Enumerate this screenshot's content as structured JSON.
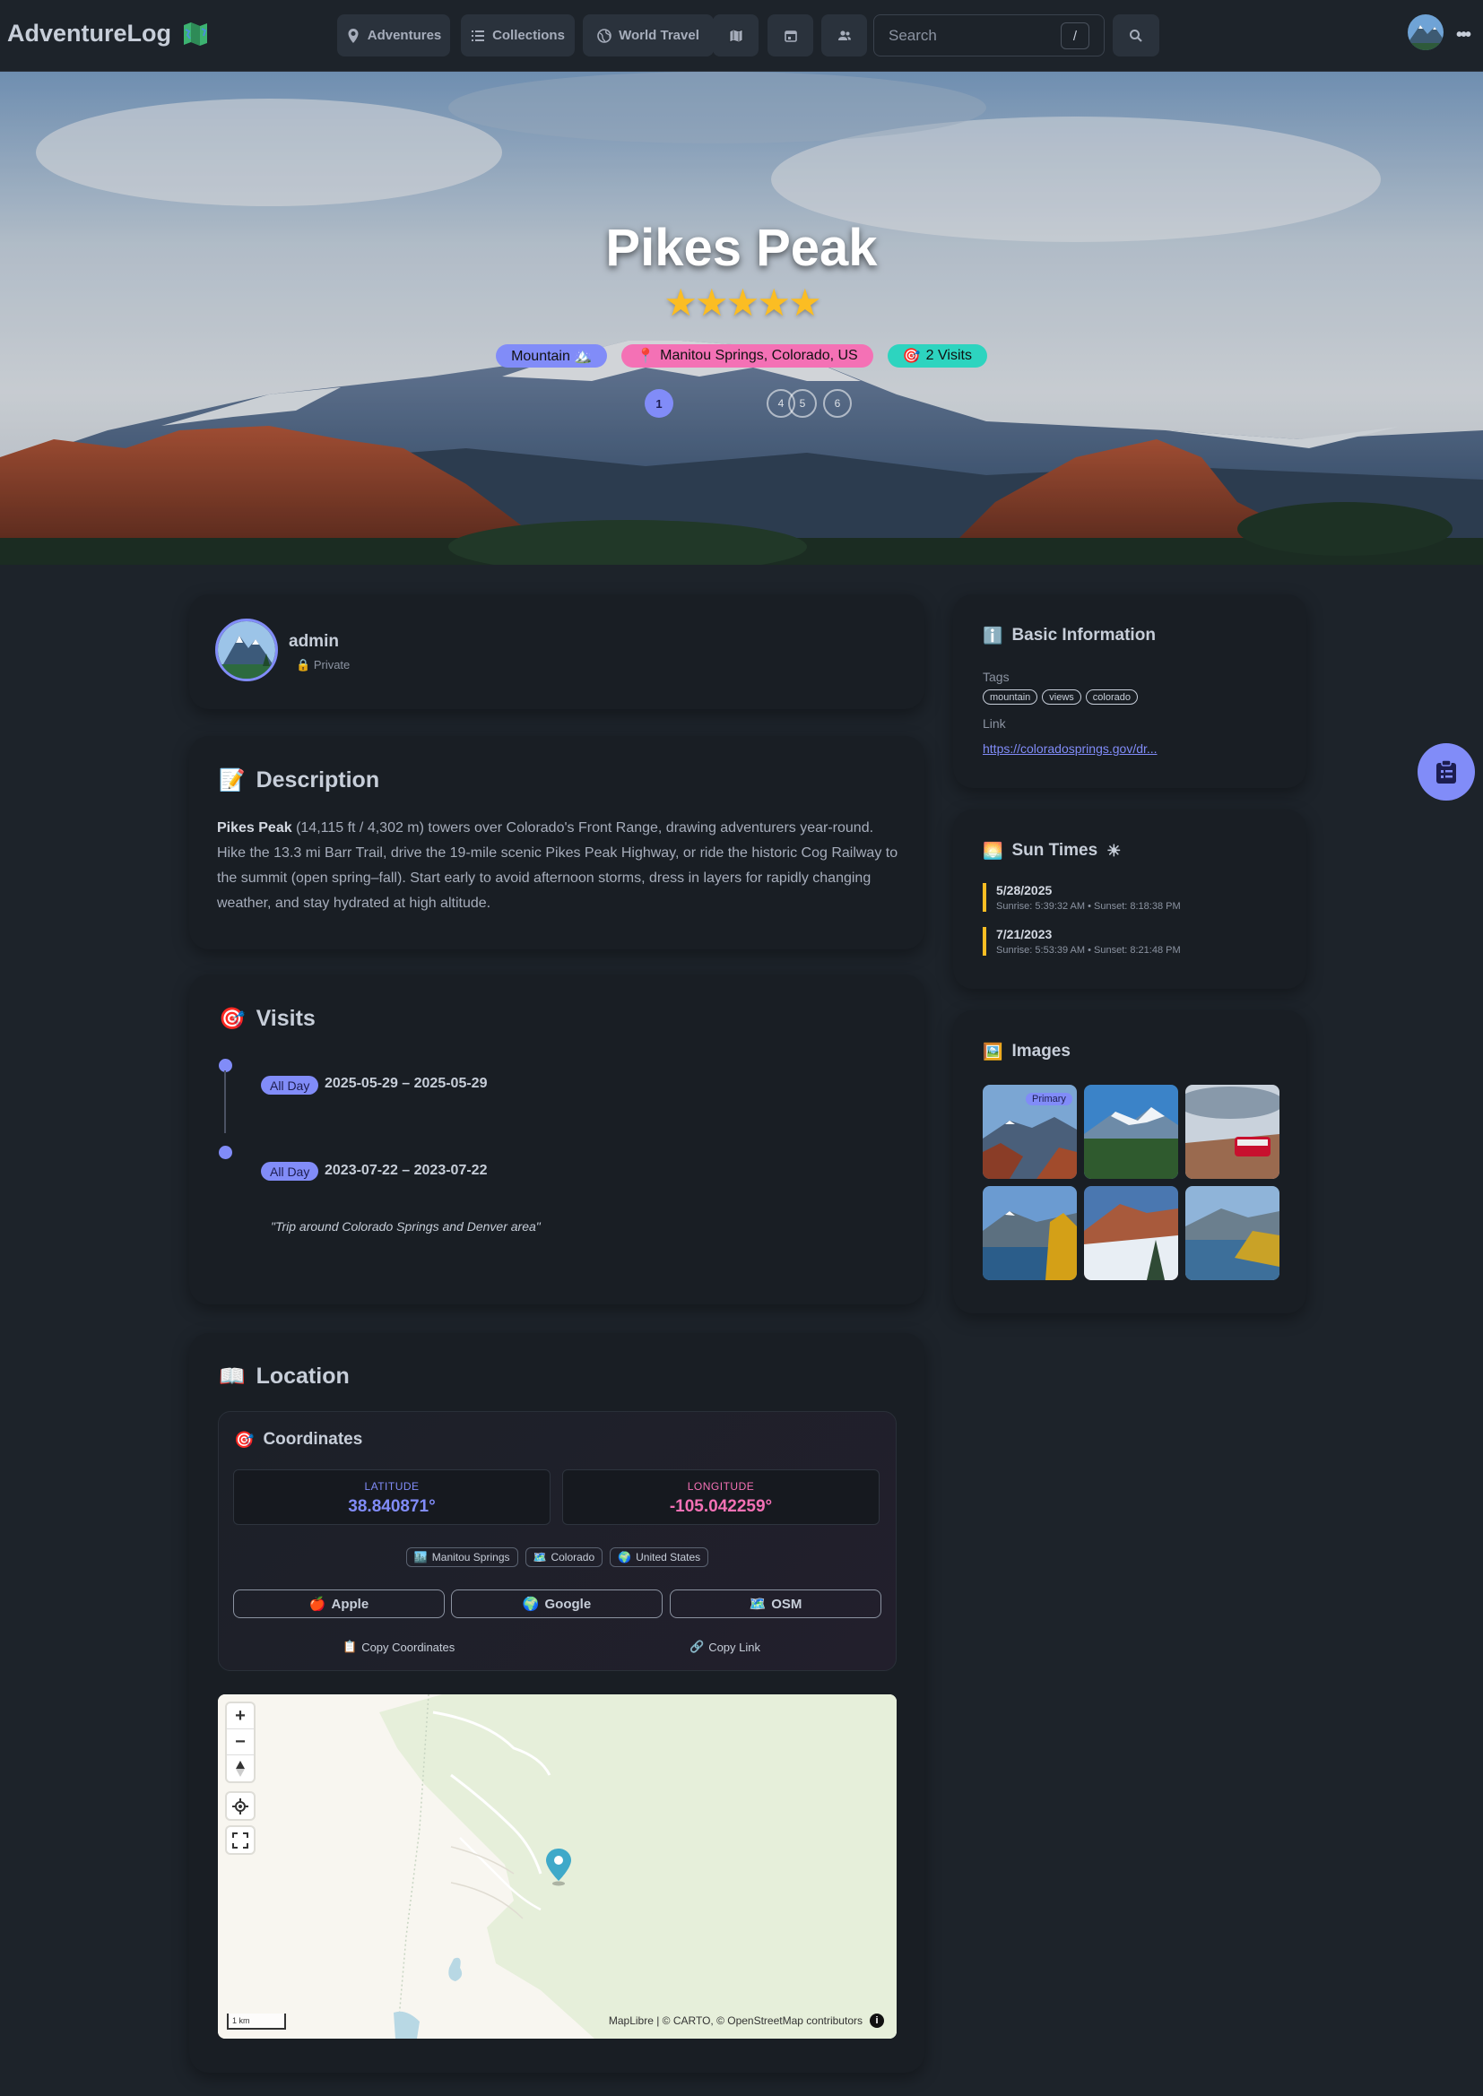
{
  "nav": {
    "brand": "AdventureLog",
    "adventures": "Adventures",
    "collections": "Collections",
    "world_travel": "World Travel",
    "search_placeholder": "Search",
    "search_key": "/",
    "more": "•••"
  },
  "hero": {
    "title": "Pikes Peak",
    "rating": 5,
    "stars": [
      "★",
      "★",
      "★",
      "★",
      "★"
    ],
    "category": "Mountain 🏔️",
    "location": "Manitou Springs, Colorado, US",
    "visits": "2 Visits",
    "carousel": {
      "active": "1",
      "ghost": [
        "4",
        "5",
        "6"
      ]
    }
  },
  "owner": {
    "name": "admin",
    "privacy": "Private"
  },
  "description": {
    "title": "Description",
    "bold": "Pikes Peak",
    "text": " (14,115 ft / 4,302 m) towers over Colorado's Front Range, drawing adventurers year-round. Hike the 13.3 mi Barr Trail, drive the 19-mile scenic Pikes Peak Highway, or ride the historic Cog Railway to the summit (open spring–fall). Start early to avoid afternoon storms, dress in layers for rapidly changing weather, and stay hydrated at high altitude."
  },
  "visits": {
    "title": "Visits",
    "items": [
      {
        "badge": "All Day",
        "range": "2025-05-29 – 2025-05-29"
      },
      {
        "badge": "All Day",
        "range": "2023-07-22 – 2023-07-22",
        "note": "\"Trip around Colorado Springs and Denver area\""
      }
    ]
  },
  "location": {
    "title": "Location",
    "coords_title": "Coordinates",
    "lat_label": "LATITUDE",
    "lat": "38.840871°",
    "lon_label": "LONGITUDE",
    "lon": "-105.042259°",
    "chips": [
      "Manitou Springs",
      "Colorado",
      "United States"
    ],
    "buttons": [
      "Apple",
      "Google",
      "OSM"
    ],
    "copy_coords": "Copy Coordinates",
    "copy_link": "Copy Link"
  },
  "map": {
    "scale": "1 km",
    "attribution": "MapLibre | © CARTO, © OpenStreetMap contributors",
    "zoom_in": "+",
    "zoom_out": "−"
  },
  "basic_info": {
    "title": "Basic Information",
    "tags_label": "Tags",
    "tags": [
      "mountain",
      "views",
      "colorado"
    ],
    "link_label": "Link",
    "link": "https://coloradosprings.gov/dr..."
  },
  "sun_times": {
    "title": "Sun Times",
    "entries": [
      {
        "date": "5/28/2025",
        "times": "Sunrise: 5:39:32 AM • Sunset: 8:18:38 PM"
      },
      {
        "date": "7/21/2023",
        "times": "Sunrise: 5:53:39 AM • Sunset: 8:21:48 PM"
      }
    ]
  },
  "images": {
    "title": "Images",
    "primary_label": "Primary",
    "count": 6
  },
  "colors": {
    "accent": "#818cf8",
    "secondary": "#f471b5",
    "teal": "#2dd4bf",
    "star": "#fbbd23",
    "bg": "#1d232a",
    "card": "#191e24"
  }
}
